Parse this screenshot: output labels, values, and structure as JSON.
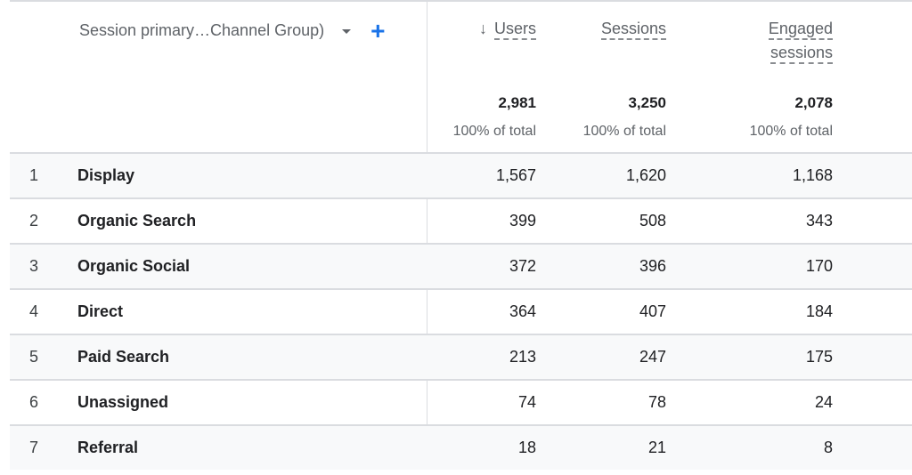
{
  "dimension": {
    "label": "Session primary…Channel Group)",
    "dropdown_icon": "caret-down-icon",
    "add_icon": "plus-icon"
  },
  "metrics": [
    {
      "title_line1": "Users",
      "title_line2": "",
      "sort_icon": "arrow-down-icon",
      "sorted": true,
      "total": "2,981",
      "pct": "100% of total"
    },
    {
      "title_line1": "Sessions",
      "title_line2": "",
      "sorted": false,
      "total": "3,250",
      "pct": "100% of total"
    },
    {
      "title_line1": "Engaged",
      "title_line2": "sessions",
      "sorted": false,
      "total": "2,078",
      "pct": "100% of total"
    }
  ],
  "sort_arrow": "↓",
  "plus_glyph": "+",
  "rows": [
    {
      "idx": "1",
      "name": "Display",
      "users": "1,567",
      "sessions": "1,620",
      "engaged": "1,168"
    },
    {
      "idx": "2",
      "name": "Organic Search",
      "users": "399",
      "sessions": "508",
      "engaged": "343"
    },
    {
      "idx": "3",
      "name": "Organic Social",
      "users": "372",
      "sessions": "396",
      "engaged": "170"
    },
    {
      "idx": "4",
      "name": "Direct",
      "users": "364",
      "sessions": "407",
      "engaged": "184"
    },
    {
      "idx": "5",
      "name": "Paid Search",
      "users": "213",
      "sessions": "247",
      "engaged": "175"
    },
    {
      "idx": "6",
      "name": "Unassigned",
      "users": "74",
      "sessions": "78",
      "engaged": "24"
    },
    {
      "idx": "7",
      "name": "Referral",
      "users": "18",
      "sessions": "21",
      "engaged": "8"
    }
  ],
  "colors": {
    "accent": "#1a73e8",
    "row_alt_bg": "#f8f9fa",
    "border": "#dadce0",
    "text_secondary": "#5f6368"
  }
}
